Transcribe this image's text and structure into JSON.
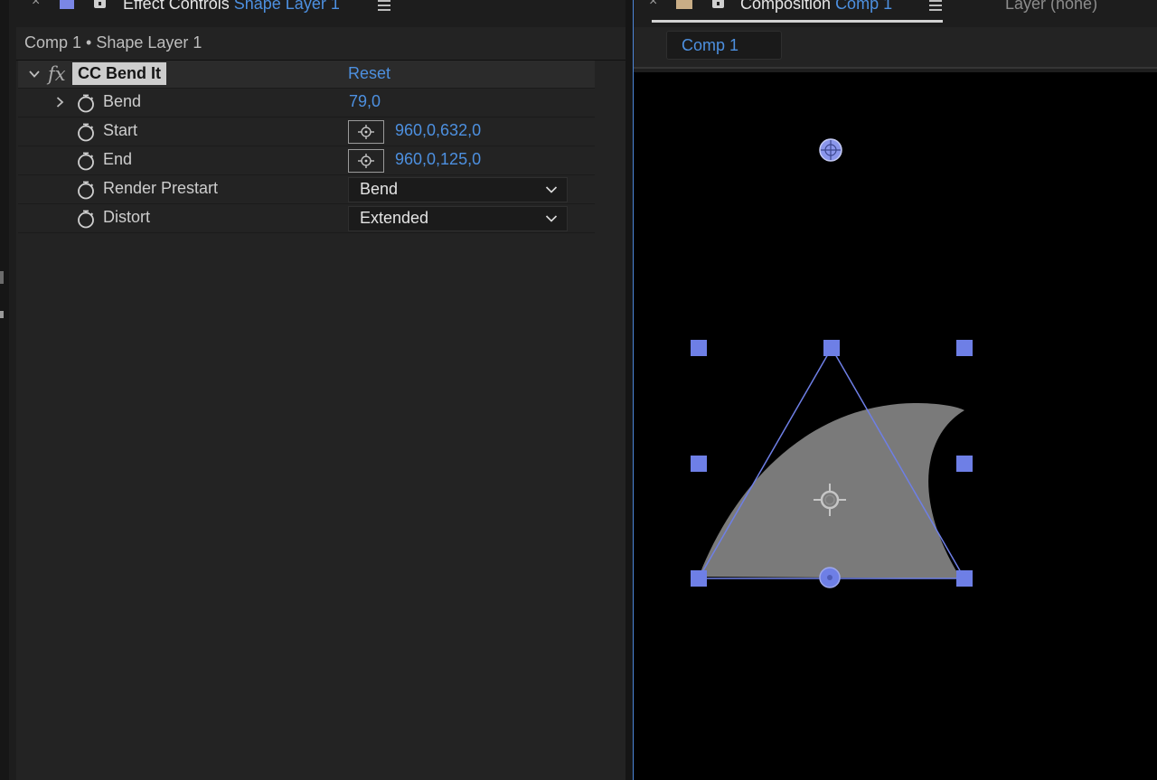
{
  "effect_controls": {
    "tab_title": "Effect Controls",
    "tab_layer": "Shape Layer 1",
    "breadcrumb": "Comp 1 • Shape Layer 1",
    "effect": {
      "name": "CC Bend It",
      "reset_label": "Reset",
      "properties": [
        {
          "name": "Bend",
          "value": "79,0"
        },
        {
          "name": "Start",
          "value": "960,0,632,0"
        },
        {
          "name": "End",
          "value": "960,0,125,0"
        },
        {
          "name": "Render Prestart",
          "value": "Bend"
        },
        {
          "name": "Distort",
          "value": "Extended"
        }
      ]
    }
  },
  "composition": {
    "tab_title": "Composition",
    "tab_comp": "Comp 1",
    "layer_tab": "Layer (none)",
    "breadcrumb": "Comp 1"
  },
  "colors": {
    "accent_blue": "#4d90e0",
    "handle_color": "#6e7fe6",
    "shape_fill": "#7a7a7a",
    "footage_label": "#c9ad86",
    "layer_label": "#7a86e6"
  },
  "icons": [
    "close-icon",
    "lock-icon",
    "panel-menu-icon",
    "chevron-down-icon",
    "chevron-right-icon",
    "stopwatch-icon",
    "crosshair-icon",
    "fx-icon"
  ]
}
